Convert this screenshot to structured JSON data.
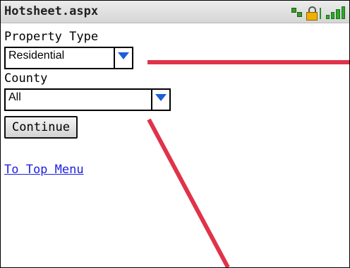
{
  "window": {
    "title": "Hotsheet.aspx"
  },
  "status_icons": [
    "network-icon",
    "lock-icon",
    "signal-icon"
  ],
  "form": {
    "property_type": {
      "label": "Property Type",
      "value": "Residential"
    },
    "county": {
      "label": "County",
      "value": "All"
    },
    "continue_label": "Continue"
  },
  "links": {
    "top_menu": "To Top Menu"
  },
  "colors": {
    "accent_arrow": "#1a5fd6",
    "link": "#2020e0",
    "annotation": "#e0334a"
  }
}
